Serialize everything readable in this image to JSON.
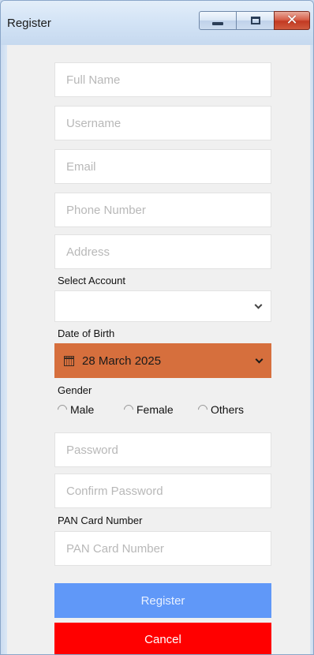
{
  "window": {
    "title": "Register",
    "close_glyph": "✕"
  },
  "form": {
    "full_name": {
      "placeholder": "Full Name"
    },
    "username": {
      "placeholder": "Username"
    },
    "email": {
      "placeholder": "Email"
    },
    "phone": {
      "placeholder": "Phone Number"
    },
    "address": {
      "placeholder": "Address"
    },
    "account": {
      "label": "Select Account",
      "value": ""
    },
    "dob": {
      "label": "Date of Birth",
      "value": "28 March 2025",
      "color": "#d66f3d"
    },
    "gender": {
      "label": "Gender",
      "options": [
        "Male",
        "Female",
        "Others"
      ]
    },
    "password": {
      "placeholder": "Password"
    },
    "confirm_password": {
      "placeholder": "Confirm Password"
    },
    "pan": {
      "label": "PAN Card Number",
      "placeholder": "PAN Card Number"
    }
  },
  "buttons": {
    "register": {
      "label": "Register",
      "color": "#6098f8"
    },
    "cancel": {
      "label": "Cancel",
      "color": "#ff0000"
    }
  },
  "icons": {
    "calendar": "calendar-icon",
    "chevron": "chevron-down-icon"
  }
}
